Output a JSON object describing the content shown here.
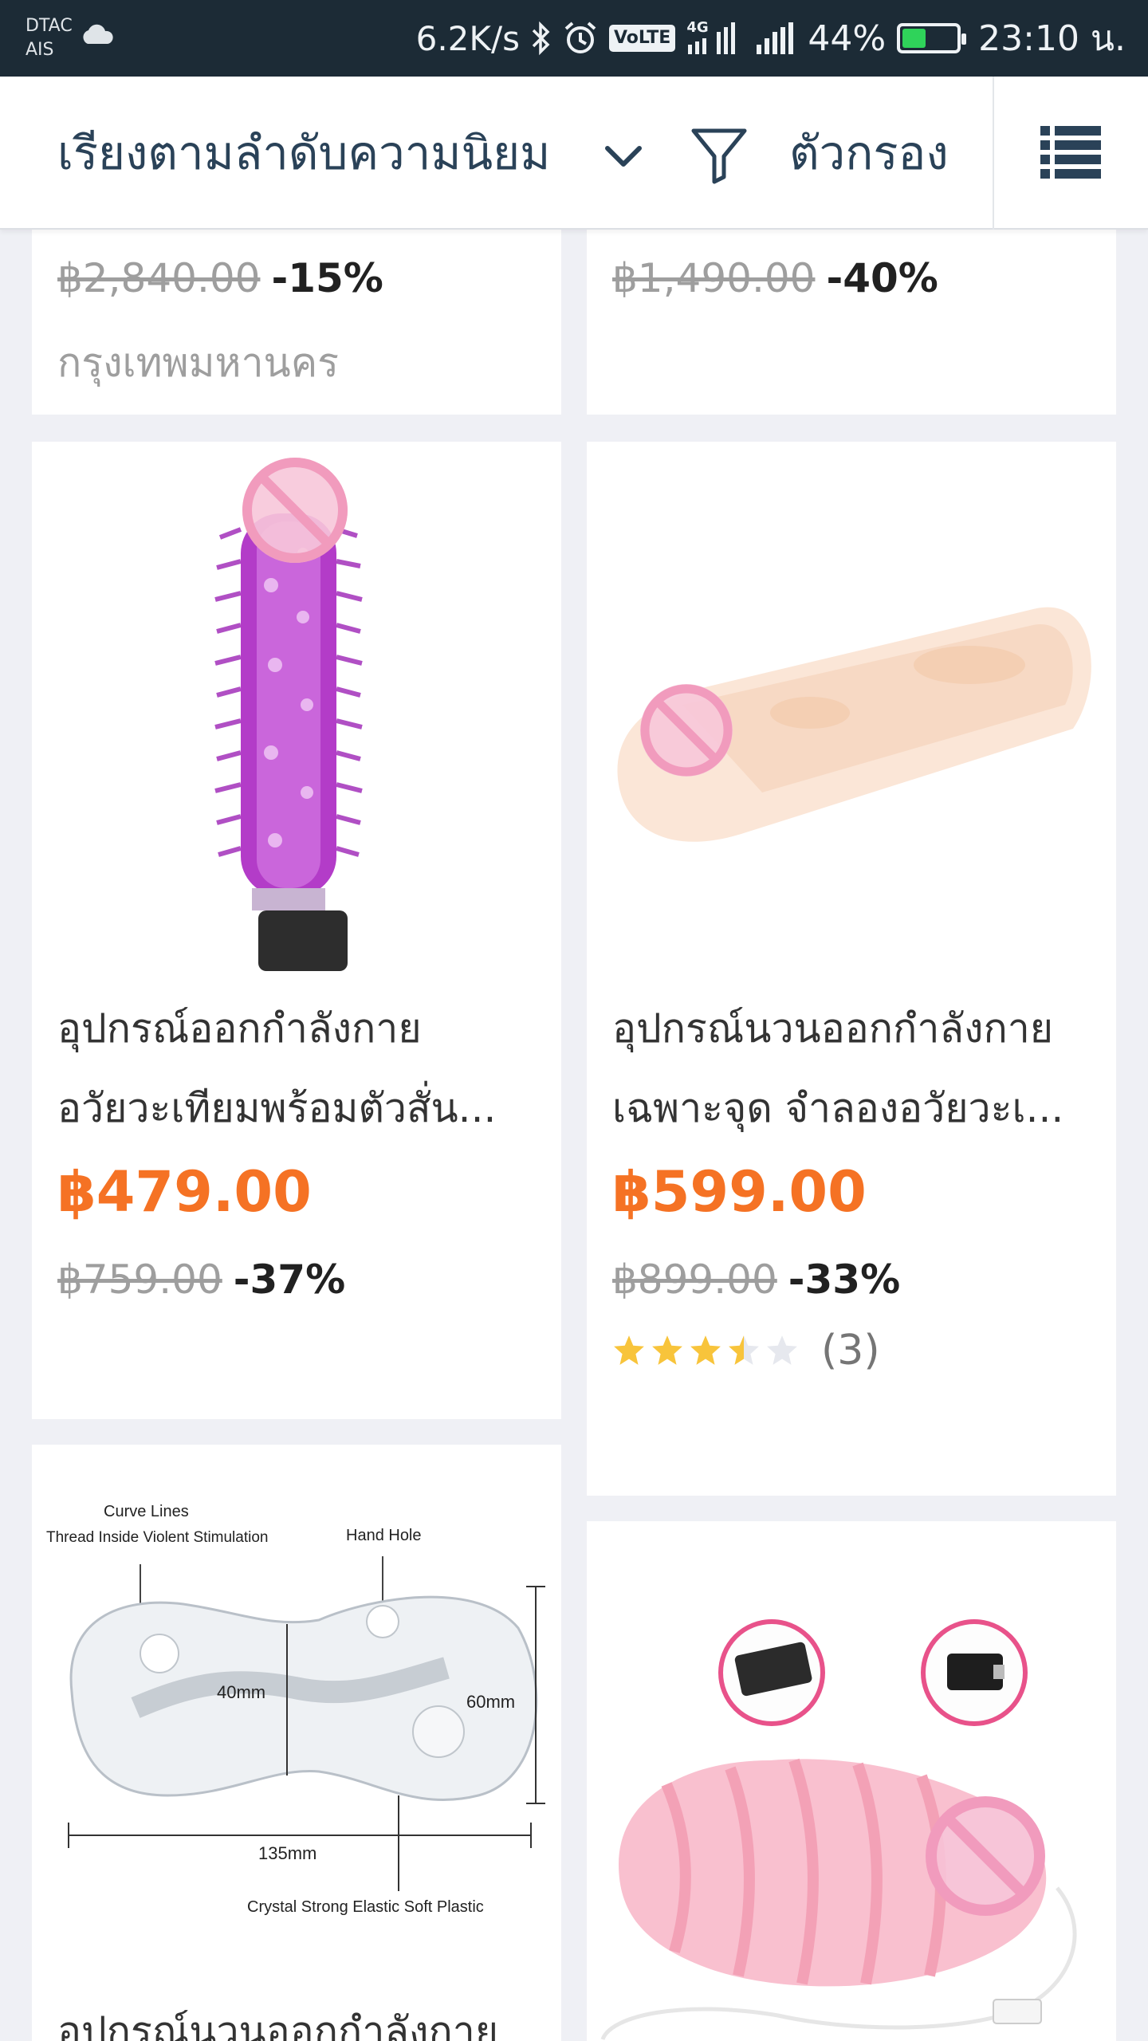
{
  "status_bar": {
    "carrier_1": "DTAC",
    "carrier_2": "AIS",
    "net_speed": "6.2K/s",
    "volte": "VoLTE",
    "net_type": "4G",
    "battery_text": "44%",
    "battery_level": 0.44,
    "time": "23:10 น."
  },
  "toolbar": {
    "sort_label": "เรียงตามลำดับความนิยม",
    "filter_label": "ตัวกรอง"
  },
  "colors": {
    "price": "#f57224",
    "rating_star": "#f8c43b",
    "header_bg": "#1c2b36"
  },
  "products": [
    {
      "original_price": "฿2,840.00",
      "discount": "-15%",
      "location": "กรุงเทพมหานคร"
    },
    {
      "original_price": "฿1,490.00",
      "discount": "-40%"
    },
    {
      "title_line1": "อุปกรณ์ออกกำลังกาย",
      "title_line2": "อวัยวะเทียมพร้อมตัวสั่น...",
      "price": "฿479.00",
      "original_price": "฿759.00",
      "discount": "-37%"
    },
    {
      "title_line1": "อุปกรณ์นวนออกกำลังกาย",
      "title_line2": "เฉพาะจุด  จำลองอวัยวะเ...",
      "price": "฿599.00",
      "original_price": "฿899.00",
      "discount": "-33%",
      "rating": 3.5,
      "review_count": "(3)"
    },
    {
      "title_line1": "อุปกรณ์นวนออกกำลังกาย",
      "image_labels": {
        "curve": "Curve Lines",
        "thread": "Thread Inside Violent Stimulation",
        "hand": "Hand Hole",
        "d40": "40mm",
        "d60": "60mm",
        "d135": "135mm",
        "material": "Crystal Strong Elastic Soft Plastic"
      }
    },
    {}
  ]
}
